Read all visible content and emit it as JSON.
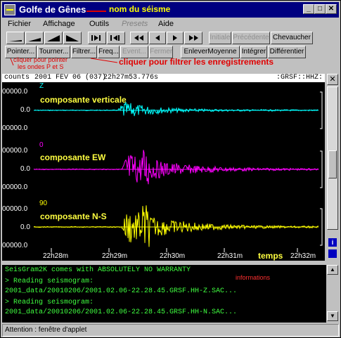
{
  "window": {
    "title": "Golfe de Gênes",
    "title_annotation": "nom du séisme",
    "controls": [
      "_",
      "□",
      "✕"
    ]
  },
  "menu": {
    "items": [
      "Fichier",
      "Affichage",
      "Outils",
      "Presets",
      "Aide"
    ]
  },
  "toolbar1": {
    "initiale": "Initiale",
    "precedente": "Précédente",
    "chevaucher": "Chevaucher"
  },
  "toolbar2": {
    "pointer": "Pointer...",
    "tourner": "Tourner...",
    "filtrer": "Filtrer...",
    "freq": "Freq...",
    "event": "Event...",
    "fermer": "Fermer",
    "enlever": "EnleverMoyenne",
    "integrer": "Intégrer",
    "differentier": "Différentier"
  },
  "annotations": {
    "filter": "cliquer pour filtrer les enregistrements",
    "pointer_line1": "cliquer pour pointer",
    "pointer_line2": "les ondes P et S",
    "info": "informations"
  },
  "plot": {
    "units": "counts",
    "date": "2001 FEV 06 (037)",
    "time": "22h27m53.776s",
    "station": ":GRSF::HHZ:",
    "y_top": "00000.0",
    "y_mid": "0.0",
    "y_bot": "00000.0",
    "time_label": "temps",
    "x_ticks": [
      "22h28m",
      "22h29m",
      "22h30m",
      "22h31m",
      "22h32m"
    ],
    "channels": [
      {
        "num": "Z",
        "title": "composante verticale",
        "color": "#00ffff"
      },
      {
        "num": "0",
        "title": "composante EW",
        "color": "#ff00ff"
      },
      {
        "num": "90",
        "title": "composante N-S",
        "color": "#ffff00"
      }
    ]
  },
  "console": {
    "lines": [
      "SeisGram2K comes with ABSOLUTELY NO WARRANTY",
      "> Reading seismogram:",
      "2001_data/20010206/2001.02.06-22.28.45.GRSF.HH-Z.SAC...",
      "> Reading seismogram:",
      "2001_data/20010206/2001.02.06-22.28.45.GRSF.HH-N.SAC..."
    ]
  },
  "status": {
    "text": "Attention : fenêtre d'applet"
  }
}
